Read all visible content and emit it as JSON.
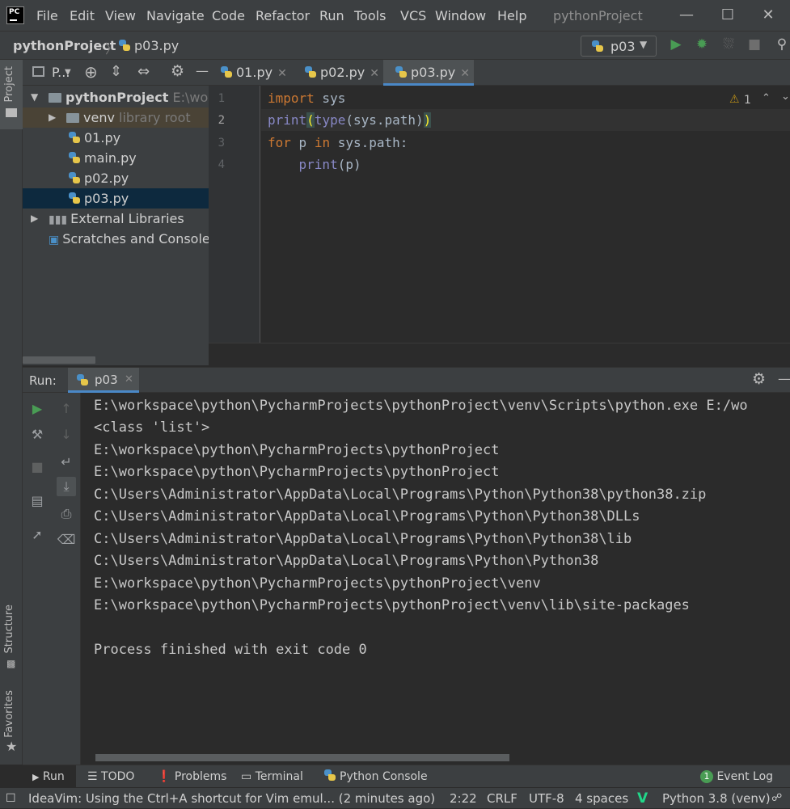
{
  "menubar": {
    "items": [
      "File",
      "Edit",
      "View",
      "Navigate",
      "Code",
      "Refactor",
      "Run",
      "Tools",
      "VCS",
      "Window",
      "Help"
    ],
    "window_title": "pythonProject",
    "app_icon_text": "PC"
  },
  "navbar": {
    "project": "pythonProject",
    "file": "p03.py",
    "run_config": "p03"
  },
  "side_tabs": {
    "project": "Project",
    "structure": "Structure",
    "favorites": "Favorites"
  },
  "project_panel": {
    "title": "P...",
    "tree": [
      {
        "label": "pythonProject",
        "hint": "E:\\works"
      },
      {
        "label": "venv",
        "hint": "library root"
      },
      {
        "label": "01.py"
      },
      {
        "label": "main.py"
      },
      {
        "label": "p02.py"
      },
      {
        "label": "p03.py"
      },
      {
        "label": "External Libraries"
      },
      {
        "label": "Scratches and Consoles"
      }
    ]
  },
  "editor": {
    "tabs": [
      "01.py",
      "p02.py",
      "p03.py"
    ],
    "active_tab": "p03.py",
    "line_numbers": [
      "1",
      "2",
      "3",
      "4"
    ],
    "warning_count": "1",
    "code": {
      "l1_kw": "import",
      "l1_rest": " sys",
      "l2_print": "print",
      "l2_open": "(",
      "l2_type": "type",
      "l2_args": "(sys.path)",
      "l2_close": ")",
      "l3_for": "for",
      "l3_p": " p ",
      "l3_in": "in",
      "l3_rest": " sys.path:",
      "l4_indent": "    ",
      "l4_print": "print",
      "l4_args": "(p)"
    }
  },
  "run_panel": {
    "label": "Run:",
    "tab": "p03",
    "output": [
      "E:\\workspace\\python\\PycharmProjects\\pythonProject\\venv\\Scripts\\python.exe E:/wo",
      "<class 'list'>",
      "E:\\workspace\\python\\PycharmProjects\\pythonProject",
      "E:\\workspace\\python\\PycharmProjects\\pythonProject",
      "C:\\Users\\Administrator\\AppData\\Local\\Programs\\Python\\Python38\\python38.zip",
      "C:\\Users\\Administrator\\AppData\\Local\\Programs\\Python\\Python38\\DLLs",
      "C:\\Users\\Administrator\\AppData\\Local\\Programs\\Python\\Python38\\lib",
      "C:\\Users\\Administrator\\AppData\\Local\\Programs\\Python\\Python38",
      "E:\\workspace\\python\\PycharmProjects\\pythonProject\\venv",
      "E:\\workspace\\python\\PycharmProjects\\pythonProject\\venv\\lib\\site-packages",
      "",
      "Process finished with exit code 0"
    ]
  },
  "bottom_tabs": {
    "run": "Run",
    "todo": "TODO",
    "problems": "Problems",
    "terminal": "Terminal",
    "python_console": "Python Console",
    "event_log": "Event Log",
    "event_count": "1"
  },
  "statusbar": {
    "message": "IdeaVim: Using the Ctrl+A shortcut for Vim emul... (2 minutes ago)",
    "position": "2:22",
    "line_sep": "CRLF",
    "encoding": "UTF-8",
    "indent": "4 spaces",
    "interpreter": "Python 3.8 (venv)"
  },
  "colors": {
    "keyword": "#cc7832",
    "builtin": "#8888c6",
    "accent": "#4a88c7",
    "run_green": "#499c54"
  }
}
